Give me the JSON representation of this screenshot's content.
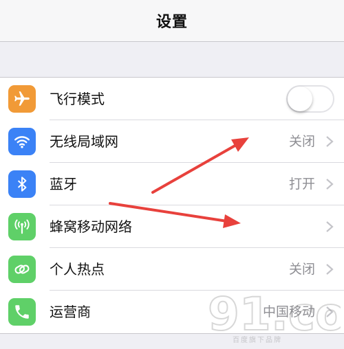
{
  "nav": {
    "title": "设置"
  },
  "rows": [
    {
      "label": "飞行模式",
      "value": "",
      "icon": "airplane-icon",
      "icon_color": "#f19a37",
      "toggle": false
    },
    {
      "label": "无线局域网",
      "value": "关闭",
      "icon": "wifi-icon",
      "icon_color": "#3b82f6"
    },
    {
      "label": "蓝牙",
      "value": "打开",
      "icon": "bluetooth-icon",
      "icon_color": "#3b82f6"
    },
    {
      "label": "蜂窝移动网络",
      "value": "",
      "icon": "cellular-antenna-icon",
      "icon_color": "#5fd068"
    },
    {
      "label": "个人热点",
      "value": "关闭",
      "icon": "hotspot-link-icon",
      "icon_color": "#5fd068"
    },
    {
      "label": "运营商",
      "value": "中国移动",
      "icon": "phone-icon",
      "icon_color": "#5fd068"
    }
  ],
  "annotation_color": "#e8413c",
  "watermark": {
    "logo": "91.com",
    "tagline": "百度旗下品牌"
  }
}
